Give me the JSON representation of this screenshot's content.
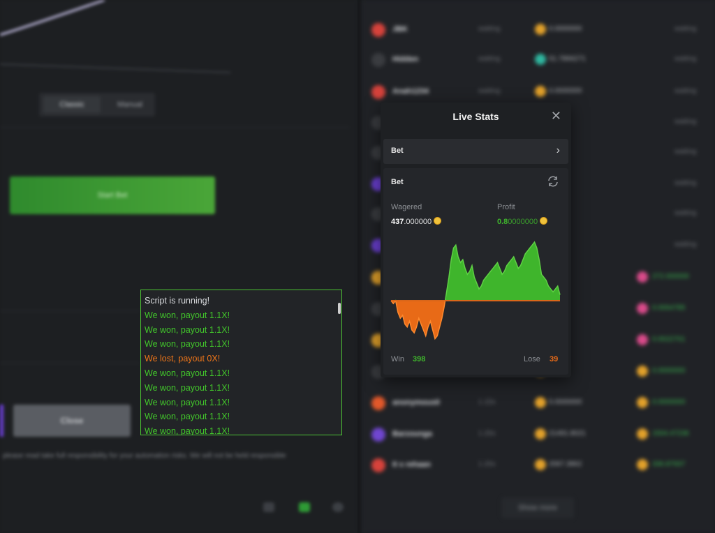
{
  "background": {
    "mode_tabs": [
      "Classic",
      "Manual"
    ],
    "start_button": "Start Bet",
    "close_button": "Close",
    "disclaimer": "please read take full responsibility for your automation risks. We will not be held responsible",
    "players": [
      {
        "name": "JBK",
        "time": "waiting",
        "amount": "0.0000000",
        "payout": "waiting",
        "avatar_color": "#d6423b"
      },
      {
        "name": "Hidden",
        "time": "waiting",
        "amount": "51.7866271",
        "payout": "waiting",
        "avatar_color": "#3a3c40"
      },
      {
        "name": "Anah1234",
        "time": "waiting",
        "amount": "0.0000000",
        "payout": "waiting",
        "avatar_color": "#d6423b"
      },
      {
        "name": "",
        "time": "",
        "amount": "",
        "payout": "waiting",
        "avatar_color": "#3a3c40"
      },
      {
        "name": "",
        "time": "",
        "amount": "",
        "payout": "waiting",
        "avatar_color": "#3a3c40"
      },
      {
        "name": "",
        "time": "",
        "amount": "",
        "payout": "waiting",
        "avatar_color": "#6a3fd2"
      },
      {
        "name": "",
        "time": "",
        "amount": "",
        "payout": "waiting",
        "avatar_color": "#3a3c40"
      },
      {
        "name": "",
        "time": "",
        "amount": "",
        "payout": "waiting",
        "avatar_color": "#6a3fd2"
      },
      {
        "name": "",
        "time": "",
        "amount": "",
        "payout": "272.000000",
        "avatar_color": "#e2a12a"
      },
      {
        "name": "",
        "time": "",
        "amount": "",
        "payout": "0.0064785",
        "avatar_color": "#3a3c40"
      },
      {
        "name": "",
        "time": "",
        "amount": "",
        "payout": "0.0022701",
        "avatar_color": "#e2a12a"
      },
      {
        "name": "",
        "time": "",
        "amount": "",
        "payout": "0.0000000",
        "avatar_color": "#3a3c40"
      },
      {
        "name": "anonymous0",
        "time": "1.10x",
        "amount": "5.0000000",
        "payout": "0.0000000",
        "avatar_color": "#e2582a"
      },
      {
        "name": "Barzounga",
        "time": "1.20x",
        "amount": "21491.8021",
        "payout": "1504.47236",
        "avatar_color": "#7046d0"
      },
      {
        "name": "It s rehaan",
        "time": "1.20x",
        "amount": "2067.3862",
        "payout": "336.87937",
        "avatar_color": "#d6423b"
      }
    ],
    "show_more": "Show more"
  },
  "live_stats": {
    "title": "Live Stats",
    "selector_label": "Bet",
    "section_label": "Bet",
    "wagered_label": "Wagered",
    "wagered_int": "437",
    "wagered_dec": ".000000",
    "profit_label": "Profit",
    "profit_int": "0.8",
    "profit_dec": "0000000",
    "win_label": "Win",
    "win_value": "398",
    "lose_label": "Lose",
    "lose_value": "39",
    "colors": {
      "profit": "#3fb52c",
      "loss": "#e86a17"
    }
  },
  "chart_data": {
    "type": "area",
    "title": "",
    "xlabel": "",
    "ylabel": "",
    "note_series": "cumulative profit per bet",
    "values": [
      0,
      -1,
      0,
      -4,
      -6,
      -5,
      -8,
      -9,
      -7,
      -10,
      -11,
      -9,
      -6,
      -8,
      -10,
      -12,
      -9,
      -7,
      -10,
      -13,
      -12,
      -9,
      -6,
      -2,
      3,
      8,
      14,
      18,
      19,
      15,
      13,
      14,
      11,
      9,
      10,
      12,
      8,
      6,
      4,
      5,
      7,
      8,
      9,
      10,
      11,
      12,
      13,
      11,
      9,
      10,
      12,
      13,
      14,
      15,
      13,
      11,
      12,
      14,
      16,
      17,
      18,
      19,
      20,
      18,
      14,
      9,
      8,
      7,
      5,
      4,
      3,
      4,
      5,
      2
    ],
    "colors": {
      "positive": "#3fb52c",
      "negative": "#e86a17"
    }
  },
  "script_log": {
    "lines": [
      {
        "text": "Script is running!",
        "color": "#d8dadd"
      },
      {
        "text": "We won, payout 1.1X!",
        "color": "#42c72b"
      },
      {
        "text": "We won, payout 1.1X!",
        "color": "#42c72b"
      },
      {
        "text": "We won, payout 1.1X!",
        "color": "#42c72b"
      },
      {
        "text": "We lost, payout 0X!",
        "color": "#f07619"
      },
      {
        "text": "We won, payout 1.1X!",
        "color": "#42c72b"
      },
      {
        "text": "We won, payout 1.1X!",
        "color": "#42c72b"
      },
      {
        "text": "We won, payout 1.1X!",
        "color": "#42c72b"
      },
      {
        "text": "We won, payout 1.1X!",
        "color": "#42c72b"
      },
      {
        "text": "We won, payout 1.1X!",
        "color": "#42c72b"
      }
    ]
  }
}
